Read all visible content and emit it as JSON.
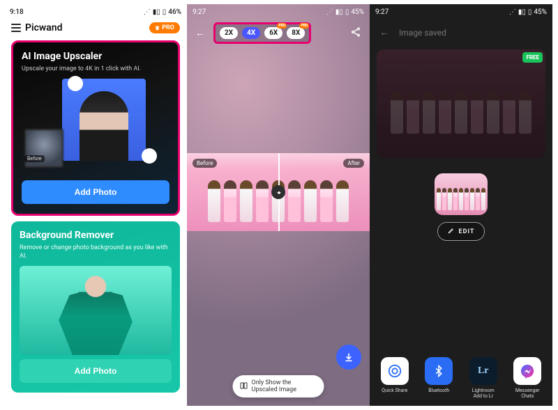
{
  "pane1": {
    "status": {
      "time": "9:18",
      "battery": "46%"
    },
    "brand": "Picwand",
    "pro": "PRO",
    "card_upscaler": {
      "title": "AI Image Upscaler",
      "sub": "Upscale your image to 4K in 1 click with AI.",
      "before": "Before",
      "cta": "Add Photo"
    },
    "card_bg": {
      "title": "Background Remover",
      "sub": "Remove or change photo background as you like with AI.",
      "cta": "Add Photo"
    }
  },
  "pane2": {
    "status": {
      "time": "9:27",
      "battery": "45%"
    },
    "zoom": {
      "x2": "2X",
      "x4": "4X",
      "x6": "6X",
      "x8": "8X",
      "pro": "PRO"
    },
    "before": "Before",
    "after": "After",
    "toggle": "Only Show the Upscaled Image"
  },
  "pane3": {
    "status": {
      "time": "9:27",
      "battery": "45%"
    },
    "title": "Image saved",
    "free": "FREE",
    "edit": "EDIT",
    "share": {
      "quick": "Quick Share",
      "bt": "Bluetooth",
      "lr": "Lightroom\nAdd to Lr",
      "ms": "Messenger\nChats"
    }
  }
}
